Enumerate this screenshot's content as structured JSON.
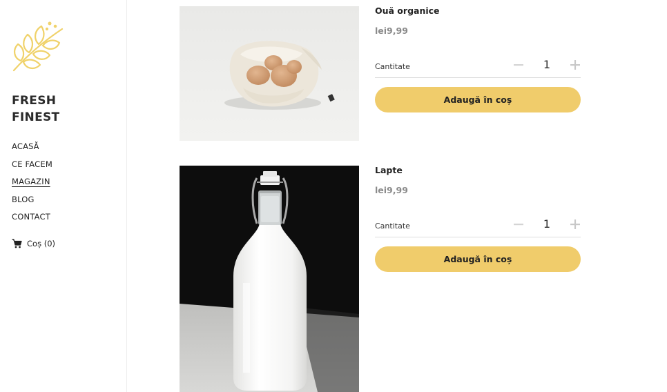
{
  "brand": {
    "line1": "FRESH",
    "line2": "FINEST"
  },
  "nav": {
    "items": [
      {
        "label": "ACASĂ"
      },
      {
        "label": "CE FACEM"
      },
      {
        "label": "MAGAZIN"
      },
      {
        "label": "BLOG"
      },
      {
        "label": "CONTACT"
      }
    ],
    "cart_label": "Coș (0)"
  },
  "products": [
    {
      "name": "Ouă organice",
      "price": "lei9,99",
      "qty_label": "Cantitate",
      "qty": "1",
      "add_label": "Adaugă în coș"
    },
    {
      "name": "Lapte",
      "price": "lei9,99",
      "qty_label": "Cantitate",
      "qty": "1",
      "add_label": "Adaugă în coș"
    }
  ],
  "colors": {
    "accent": "#f0cc6b",
    "logo": "#f0d26a",
    "price": "#8a8a8a"
  },
  "icons": {
    "logo": "wheat-logo-icon",
    "cart": "cart-icon",
    "minus": "minus-icon",
    "plus": "plus-icon"
  }
}
